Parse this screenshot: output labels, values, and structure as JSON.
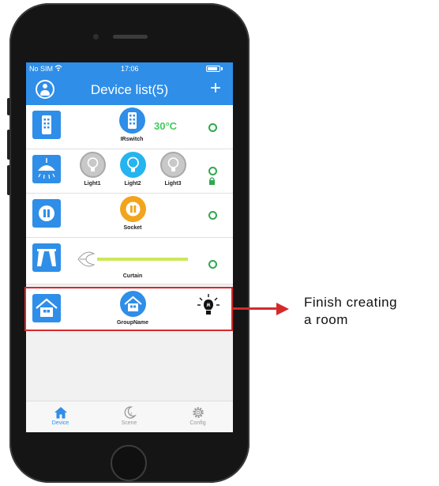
{
  "annotation": {
    "line1": "Finish creating",
    "line2": "a room"
  },
  "status_bar": {
    "carrier": "No SIM",
    "time": "17:06"
  },
  "header": {
    "title": "Device list(5)",
    "add_label": "+"
  },
  "rows": [
    {
      "room_icon": "remote-icon",
      "devices": [
        {
          "label": "IRswitch",
          "icon": "remote-icon"
        }
      ],
      "temperature": "30°C",
      "status_icon": "online-dot-icon"
    },
    {
      "room_icon": "ceiling-lamp-icon",
      "devices": [
        {
          "label": "Light1",
          "icon": "bulb-icon"
        },
        {
          "label": "Light2",
          "icon": "bulb-icon"
        },
        {
          "label": "Light3",
          "icon": "bulb-icon"
        }
      ],
      "status_icon": "online-dot-icon",
      "lock_icon": "lock-icon"
    },
    {
      "room_icon": "pause-icon",
      "devices": [
        {
          "label": "Socket",
          "icon": "pause-icon"
        }
      ],
      "status_icon": "online-dot-icon"
    },
    {
      "room_icon": "curtain-icon",
      "devices": [
        {
          "label": "Curtain",
          "icon": "curtain-slider"
        }
      ],
      "curtain_level": 1.0,
      "status_icon": "online-dot-icon"
    },
    {
      "room_icon": "home-icon",
      "devices": [
        {
          "label": "GroupName",
          "icon": "home-icon"
        }
      ],
      "extra_icon": "bulb-idea-icon"
    }
  ],
  "tabs": [
    {
      "label": "Device",
      "icon": "home-icon",
      "active": true
    },
    {
      "label": "Scene",
      "icon": "moon-icon",
      "active": false
    },
    {
      "label": "Config",
      "icon": "gear-icon",
      "active": false
    }
  ],
  "colors": {
    "brand_blue": "#2f8ee8",
    "online_green": "#2fa84f",
    "temp_green": "#3fcc5a",
    "highlight_red": "#d52a2a",
    "socket_orange": "#f2a41c"
  }
}
